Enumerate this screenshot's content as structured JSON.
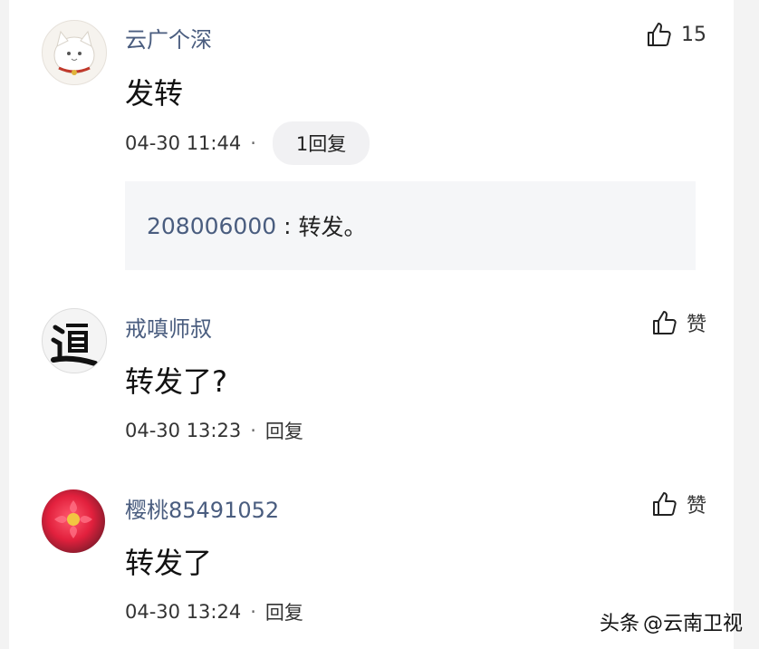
{
  "comments": [
    {
      "username": "云广个深",
      "text": "发转",
      "time": "04-30 11:44",
      "separator": "·",
      "reply_label": "1回复",
      "like_label": "15",
      "avatar_icon": "cat-avatar-icon",
      "reply": {
        "user": "208006000",
        "colon": " : ",
        "text": "转发。"
      }
    },
    {
      "username": "戒嗔师叔",
      "text": "转发了?",
      "time": "04-30 13:23",
      "separator": "·",
      "reply_label": "回复",
      "like_label": "赞",
      "avatar_icon": "calligraphy-dao-avatar-icon"
    },
    {
      "username": "樱桃85491052",
      "text": "转发了",
      "time": "04-30 13:24",
      "separator": "·",
      "reply_label": "回复",
      "like_label": "赞",
      "avatar_icon": "flower-avatar-icon"
    }
  ],
  "watermark": {
    "prefix": "头条",
    "handle": "@云南卫视"
  },
  "colors": {
    "username": "#4a5d7f",
    "text": "#111111",
    "reply_bg": "#f5f6f8"
  }
}
